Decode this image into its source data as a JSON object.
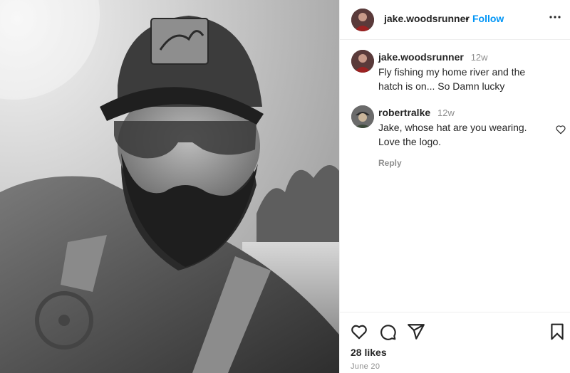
{
  "post": {
    "author": "jake.woodsrunner",
    "follow_label": "Follow",
    "separator": "•",
    "caption": {
      "username": "jake.woodsrunner",
      "time": "12w",
      "text": "Fly fishing my home river and the hatch is on... So Damn lucky"
    },
    "comments": [
      {
        "username": "robertralke",
        "time": "12w",
        "text": "Jake, whose hat are you wearing. Love the logo.",
        "reply_label": "Reply"
      }
    ],
    "likes": "28 likes",
    "date": "June 20"
  },
  "icons": {
    "more": "more-options-icon",
    "like": "heart-icon",
    "comment": "comment-icon",
    "share": "share-icon",
    "save": "bookmark-icon"
  },
  "colors": {
    "accent": "#0095f6",
    "text": "#262626",
    "muted": "#8e8e8e"
  }
}
